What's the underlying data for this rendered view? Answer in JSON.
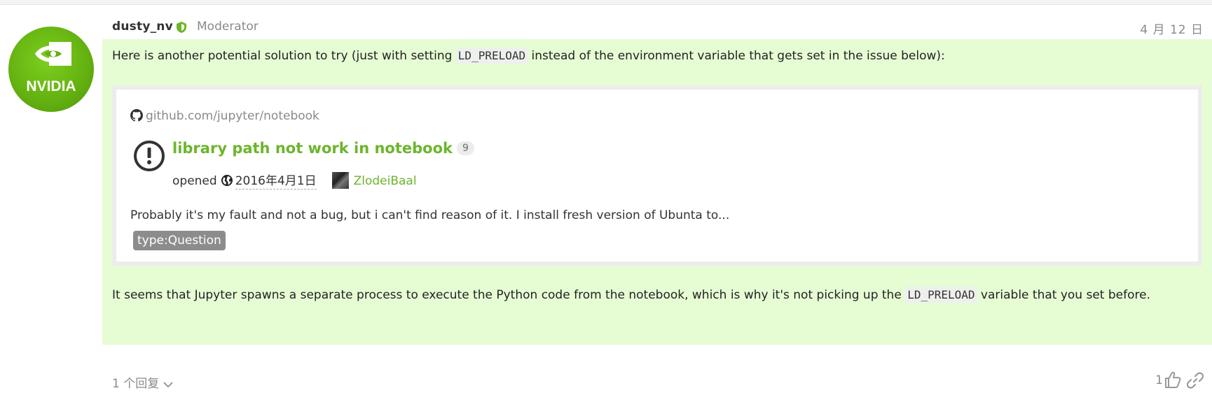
{
  "post": {
    "author": {
      "username": "dusty_nv",
      "role": "Moderator",
      "avatar_icon": "nvidia-logo",
      "avatar_text": "NVIDIA"
    },
    "date": "4 月 12 日",
    "paragraph1": {
      "before": "Here is another potential solution to try (just with setting ",
      "code": "LD_PRELOAD",
      "after": " instead of the environment variable that gets set in the issue below):"
    },
    "onebox": {
      "source": "github.com/jupyter/notebook",
      "source_icon": "github-icon",
      "issue_icon": "issue-opened-icon",
      "title": "library path not work in notebook",
      "count": "9",
      "opened_label": "opened",
      "opened_date": "2016年4月1日",
      "author": "ZlodeiBaal",
      "excerpt": "Probably it's my fault and not a bug, but i can't find reason of it. I install fresh version of Ubunta to...",
      "label": "type:Question"
    },
    "paragraph2": {
      "before": "It seems that Jupyter spawns a separate process to execute the Python code from the notebook, which is why it's not picking up the ",
      "code": "LD_PRELOAD",
      "after": " variable that you set before."
    },
    "footer": {
      "replies_label": "1 个回复",
      "likes_count": "1"
    }
  },
  "colors": {
    "accent_green": "#6cb52c",
    "post_background": "#e6fdd4",
    "avatar_green": "#63b010"
  }
}
